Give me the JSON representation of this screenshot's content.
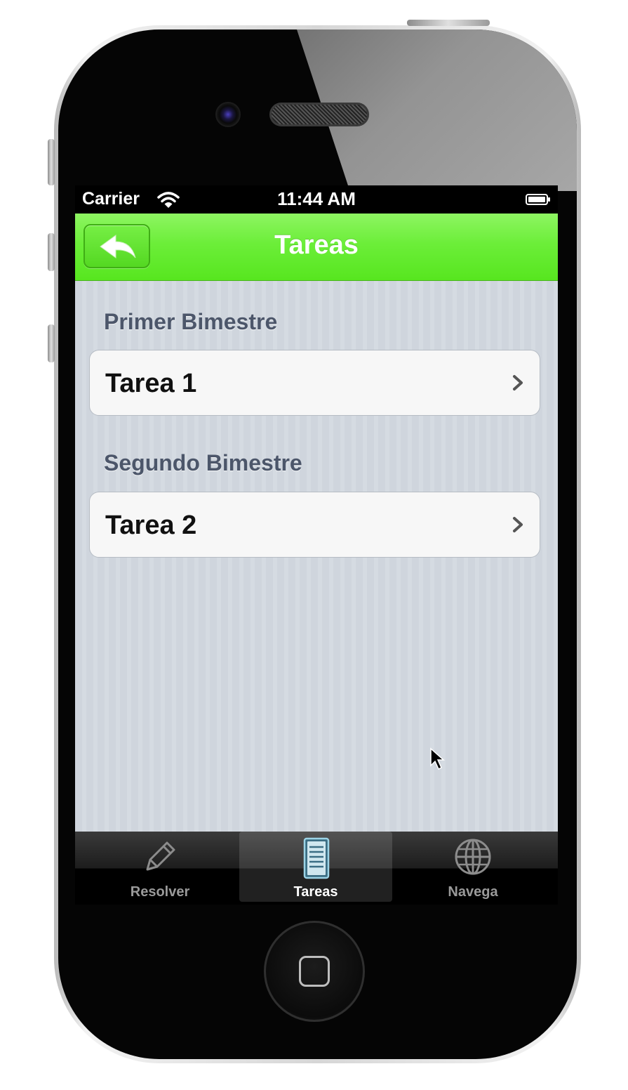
{
  "status_bar": {
    "carrier": "Carrier",
    "time": "11:44 AM"
  },
  "nav_bar": {
    "title": "Tareas",
    "back_icon": "reply-arrow-icon"
  },
  "sections": [
    {
      "header": "Primer Bimestre",
      "rows": [
        {
          "label": "Tarea 1"
        }
      ]
    },
    {
      "header": "Segundo Bimestre",
      "rows": [
        {
          "label": "Tarea 2"
        }
      ]
    }
  ],
  "tab_bar": {
    "tabs": [
      {
        "label": "Resolver",
        "icon": "pencil-icon",
        "selected": false
      },
      {
        "label": "Tareas",
        "icon": "notebook-icon",
        "selected": true
      },
      {
        "label": "Navega",
        "icon": "globe-icon",
        "selected": false
      }
    ]
  },
  "colors": {
    "nav_green": "#6cee39",
    "background": "#d4d9df",
    "tab_bar": "#1d1d1d"
  }
}
